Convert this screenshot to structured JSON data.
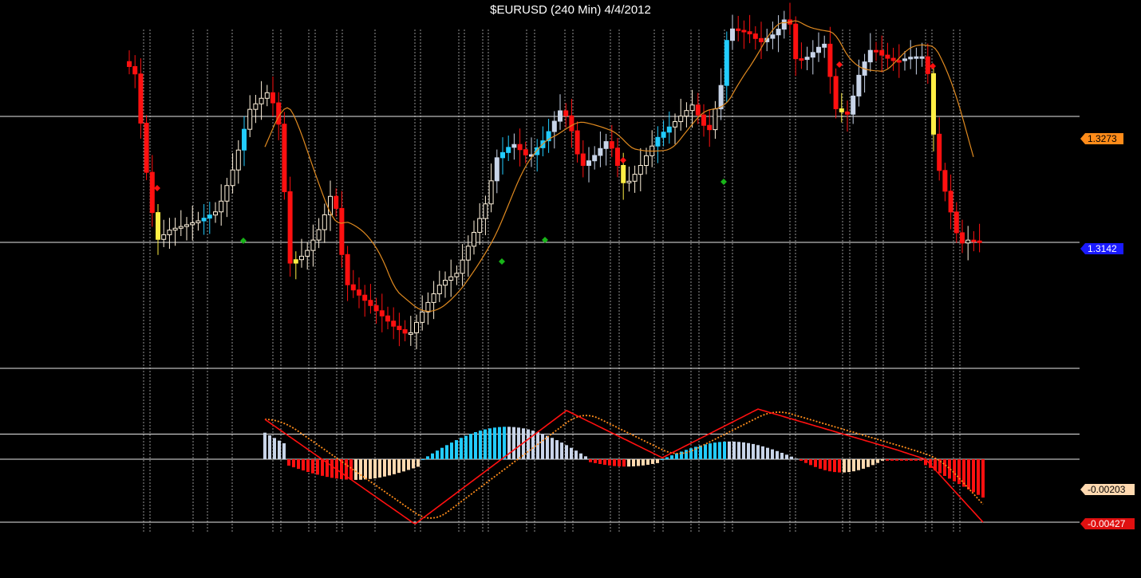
{
  "window": {
    "title": "$EURUSD (240 Min)  4/4/2012"
  },
  "colors": {
    "background": "#000000",
    "grid": "#e8e8e8",
    "bull_candle": "#fff2dc",
    "bear_candle": "#ff1010",
    "bull_strong": "#22ccff",
    "bear_weak": "#c8d4e8",
    "yellow_bar": "#ffee44",
    "ma_line": "#e08a20",
    "macd_line": "#ff1010",
    "macd_line_alt": "#22aaff",
    "signal_line": "#ff8c1a",
    "diamond_red": "#ff1010",
    "diamond_green": "#18b418",
    "label_orange": "#ff8c1a",
    "label_blue": "#1a1aff",
    "label_peach": "#ffd9b0",
    "label_red": "#e01010"
  },
  "price_labels": [
    {
      "text": "1.3273",
      "value": 1.3273,
      "style": "orange"
    },
    {
      "text": "1.3142",
      "value": 1.3142,
      "style": "blue"
    }
  ],
  "macd_labels": [
    {
      "text": "-0.00203",
      "value": -0.00203,
      "style": "peach"
    },
    {
      "text": "-0.00427",
      "value": -0.00427,
      "style": "red"
    }
  ],
  "chart_data": {
    "type": "candlestick",
    "title": "$EURUSD (240 Min)  4/4/2012",
    "price_range": [
      1.3025,
      1.3405
    ],
    "price_gridlines": [
      1.3273,
      1.3142,
      1.3011
    ],
    "macd_range": [
      -0.0046,
      0.0035
    ],
    "macd_gridlines": [
      0.0017,
      0.0,
      -0.00427
    ],
    "current_price": 1.3142,
    "moving_average": 1.3273,
    "macd_value": -0.00427,
    "signal_value": -0.00203,
    "trend": "rise from ~1.3045 to ~1.338 peak, then fall to ~1.314"
  }
}
